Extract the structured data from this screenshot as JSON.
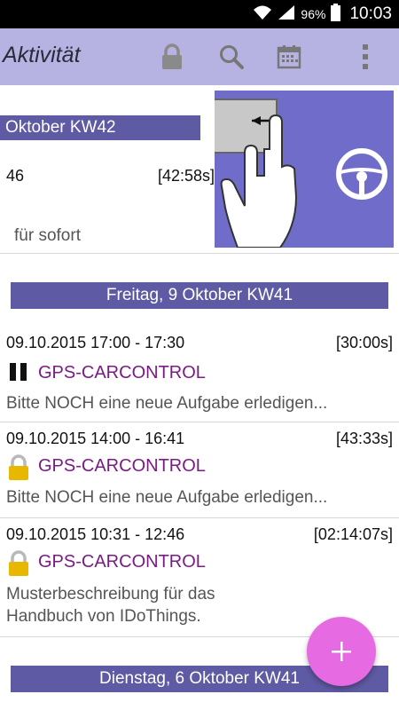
{
  "status_bar": {
    "battery_percent": "96%",
    "time": "10:03"
  },
  "app_bar": {
    "title": "Aktivität",
    "icons": [
      "lock-icon",
      "search-icon",
      "calendar-icon",
      "overflow-menu-icon"
    ]
  },
  "partial_section": {
    "header": "Oktober KW42",
    "header_prefix": "",
    "time_fragment": "46",
    "duration": "[42:58s]",
    "desc_fragment": "für sofort"
  },
  "sections": [
    {
      "header": "Freitag, 9 Oktober KW41",
      "entries": [
        {
          "time": "09.10.2015 17:00 - 17:30",
          "duration": "[30:00s]",
          "status_icon": "pause-icon",
          "company": "GPS-CARCONTROL",
          "description": "Bitte NOCH eine neue Aufgabe erledigen..."
        },
        {
          "time": "09.10.2015 14:00 - 16:41",
          "duration": "[43:33s]",
          "status_icon": "lock-icon",
          "company": "GPS-CARCONTROL",
          "description": "Bitte NOCH eine neue Aufgabe erledigen..."
        },
        {
          "time": "09.10.2015 10:31 - 12:46",
          "duration": "[02:14:07s]",
          "status_icon": "lock-icon",
          "company": "GPS-CARCONTROL",
          "description_line1": "Musterbeschreibung für das",
          "description_line2": "Handbuch von IDoThings."
        }
      ]
    },
    {
      "header": "Dienstag, 6 Oktober KW41"
    }
  ],
  "colors": {
    "appbar": "#b6b3e2",
    "section_header": "#5e5aa3",
    "company": "#7b1b86",
    "fab": "#e66be2",
    "tutorial_bg": "#6f6dc9"
  }
}
